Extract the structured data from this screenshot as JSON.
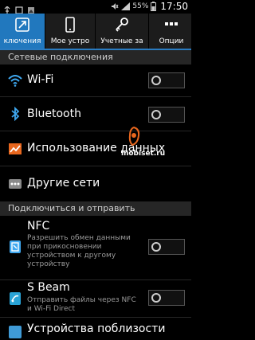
{
  "status_bar": {
    "battery_percent": "55%",
    "time": "17:50"
  },
  "tabs": [
    {
      "label": "ключения",
      "icon": "connections-icon",
      "active": true
    },
    {
      "label": "Мое устро",
      "icon": "phone-icon",
      "active": false
    },
    {
      "label": "Учетные за",
      "icon": "key-icon",
      "active": false
    },
    {
      "label": "Опции",
      "icon": "more-icon",
      "active": false
    }
  ],
  "sections": {
    "network": "Сетевые подключения",
    "connect_share": "Подключиться и отправить"
  },
  "items": {
    "wifi": {
      "label": "Wi-Fi",
      "toggle_on": false
    },
    "bluetooth": {
      "label": "Bluetooth",
      "toggle_on": false
    },
    "data_usage": {
      "label": "Использование данных"
    },
    "other_networks": {
      "label": "Другие сети"
    },
    "nfc": {
      "label": "NFC",
      "sub": "Разрешить обмен данными при прикосновении устройством к другому устройству",
      "toggle_on": false
    },
    "sbeam": {
      "label": "S Beam",
      "sub": "Отправить файлы через NFC и Wi-Fi Direct",
      "toggle_on": false
    },
    "nearby": {
      "label": "Устройства поблизости"
    }
  },
  "watermark": "mobiset.ru",
  "colors": {
    "accent": "#2178be",
    "section_bg": "#262626"
  }
}
